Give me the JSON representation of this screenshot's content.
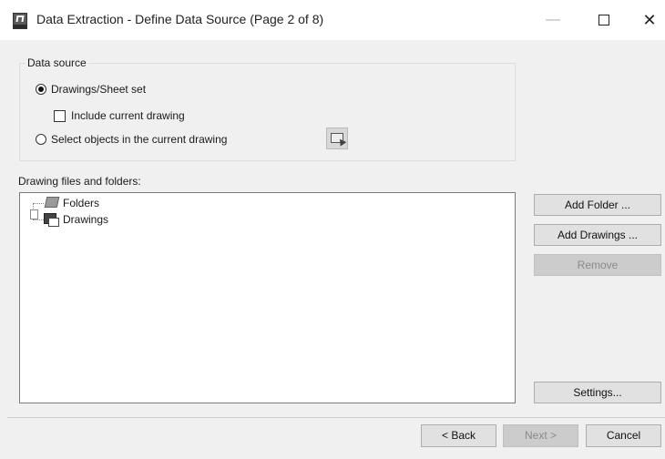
{
  "window": {
    "title": "Data Extraction - Define Data Source (Page 2 of 8)",
    "controls": [
      "—",
      "☐",
      "✕"
    ]
  },
  "data_source": {
    "legend": "Data source",
    "options": [
      {
        "label": "Drawings/Sheet set",
        "selected": true
      },
      {
        "label": "Select objects in the current drawing",
        "selected": false
      }
    ],
    "include_current_drawing": {
      "label": "Include current drawing",
      "checked": false
    }
  },
  "files": {
    "label": "Drawing files and folders:",
    "tree": [
      {
        "label": "Folders",
        "icon": "folder-icon"
      },
      {
        "label": "Drawings",
        "icon": "drawings-icon"
      }
    ]
  },
  "side_buttons": {
    "add_folder": "Add Folder ...",
    "add_drawings": "Add Drawings ...",
    "remove": "Remove",
    "settings": "Settings..."
  },
  "footer": {
    "back": "< Back",
    "next": "Next >",
    "cancel": "Cancel"
  },
  "colors": {
    "dialog_bg": "#f0f0f0",
    "button_bg": "#e1e1e1",
    "disabled_button_bg": "#cccccc"
  }
}
